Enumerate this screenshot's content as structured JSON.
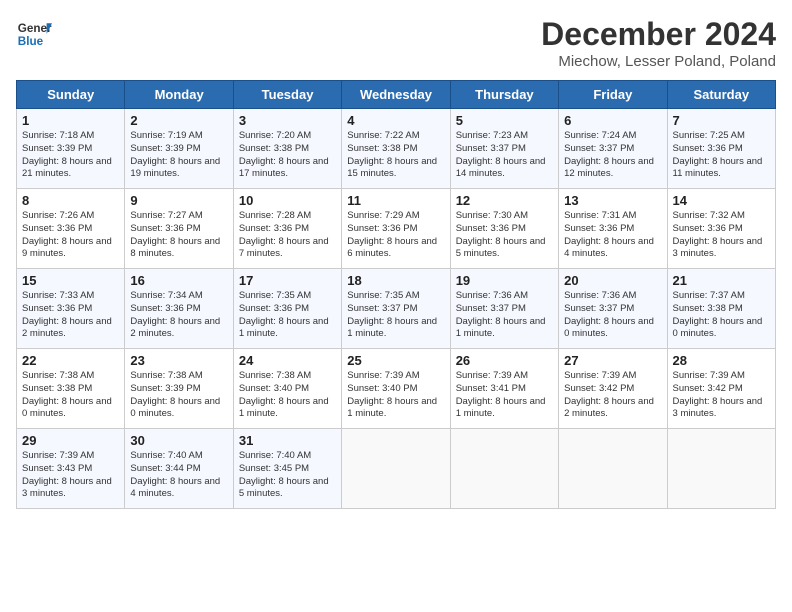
{
  "header": {
    "logo_line1": "General",
    "logo_line2": "Blue",
    "title": "December 2024",
    "subtitle": "Miechow, Lesser Poland, Poland"
  },
  "days_of_week": [
    "Sunday",
    "Monday",
    "Tuesday",
    "Wednesday",
    "Thursday",
    "Friday",
    "Saturday"
  ],
  "weeks": [
    [
      {
        "day": "1",
        "text": "Sunrise: 7:18 AM\nSunset: 3:39 PM\nDaylight: 8 hours and 21 minutes."
      },
      {
        "day": "2",
        "text": "Sunrise: 7:19 AM\nSunset: 3:39 PM\nDaylight: 8 hours and 19 minutes."
      },
      {
        "day": "3",
        "text": "Sunrise: 7:20 AM\nSunset: 3:38 PM\nDaylight: 8 hours and 17 minutes."
      },
      {
        "day": "4",
        "text": "Sunrise: 7:22 AM\nSunset: 3:38 PM\nDaylight: 8 hours and 15 minutes."
      },
      {
        "day": "5",
        "text": "Sunrise: 7:23 AM\nSunset: 3:37 PM\nDaylight: 8 hours and 14 minutes."
      },
      {
        "day": "6",
        "text": "Sunrise: 7:24 AM\nSunset: 3:37 PM\nDaylight: 8 hours and 12 minutes."
      },
      {
        "day": "7",
        "text": "Sunrise: 7:25 AM\nSunset: 3:36 PM\nDaylight: 8 hours and 11 minutes."
      }
    ],
    [
      {
        "day": "8",
        "text": "Sunrise: 7:26 AM\nSunset: 3:36 PM\nDaylight: 8 hours and 9 minutes."
      },
      {
        "day": "9",
        "text": "Sunrise: 7:27 AM\nSunset: 3:36 PM\nDaylight: 8 hours and 8 minutes."
      },
      {
        "day": "10",
        "text": "Sunrise: 7:28 AM\nSunset: 3:36 PM\nDaylight: 8 hours and 7 minutes."
      },
      {
        "day": "11",
        "text": "Sunrise: 7:29 AM\nSunset: 3:36 PM\nDaylight: 8 hours and 6 minutes."
      },
      {
        "day": "12",
        "text": "Sunrise: 7:30 AM\nSunset: 3:36 PM\nDaylight: 8 hours and 5 minutes."
      },
      {
        "day": "13",
        "text": "Sunrise: 7:31 AM\nSunset: 3:36 PM\nDaylight: 8 hours and 4 minutes."
      },
      {
        "day": "14",
        "text": "Sunrise: 7:32 AM\nSunset: 3:36 PM\nDaylight: 8 hours and 3 minutes."
      }
    ],
    [
      {
        "day": "15",
        "text": "Sunrise: 7:33 AM\nSunset: 3:36 PM\nDaylight: 8 hours and 2 minutes."
      },
      {
        "day": "16",
        "text": "Sunrise: 7:34 AM\nSunset: 3:36 PM\nDaylight: 8 hours and 2 minutes."
      },
      {
        "day": "17",
        "text": "Sunrise: 7:35 AM\nSunset: 3:36 PM\nDaylight: 8 hours and 1 minute."
      },
      {
        "day": "18",
        "text": "Sunrise: 7:35 AM\nSunset: 3:37 PM\nDaylight: 8 hours and 1 minute."
      },
      {
        "day": "19",
        "text": "Sunrise: 7:36 AM\nSunset: 3:37 PM\nDaylight: 8 hours and 1 minute."
      },
      {
        "day": "20",
        "text": "Sunrise: 7:36 AM\nSunset: 3:37 PM\nDaylight: 8 hours and 0 minutes."
      },
      {
        "day": "21",
        "text": "Sunrise: 7:37 AM\nSunset: 3:38 PM\nDaylight: 8 hours and 0 minutes."
      }
    ],
    [
      {
        "day": "22",
        "text": "Sunrise: 7:38 AM\nSunset: 3:38 PM\nDaylight: 8 hours and 0 minutes."
      },
      {
        "day": "23",
        "text": "Sunrise: 7:38 AM\nSunset: 3:39 PM\nDaylight: 8 hours and 0 minutes."
      },
      {
        "day": "24",
        "text": "Sunrise: 7:38 AM\nSunset: 3:40 PM\nDaylight: 8 hours and 1 minute."
      },
      {
        "day": "25",
        "text": "Sunrise: 7:39 AM\nSunset: 3:40 PM\nDaylight: 8 hours and 1 minute."
      },
      {
        "day": "26",
        "text": "Sunrise: 7:39 AM\nSunset: 3:41 PM\nDaylight: 8 hours and 1 minute."
      },
      {
        "day": "27",
        "text": "Sunrise: 7:39 AM\nSunset: 3:42 PM\nDaylight: 8 hours and 2 minutes."
      },
      {
        "day": "28",
        "text": "Sunrise: 7:39 AM\nSunset: 3:42 PM\nDaylight: 8 hours and 3 minutes."
      }
    ],
    [
      {
        "day": "29",
        "text": "Sunrise: 7:39 AM\nSunset: 3:43 PM\nDaylight: 8 hours and 3 minutes."
      },
      {
        "day": "30",
        "text": "Sunrise: 7:40 AM\nSunset: 3:44 PM\nDaylight: 8 hours and 4 minutes."
      },
      {
        "day": "31",
        "text": "Sunrise: 7:40 AM\nSunset: 3:45 PM\nDaylight: 8 hours and 5 minutes."
      },
      {
        "day": "",
        "text": ""
      },
      {
        "day": "",
        "text": ""
      },
      {
        "day": "",
        "text": ""
      },
      {
        "day": "",
        "text": ""
      }
    ]
  ]
}
